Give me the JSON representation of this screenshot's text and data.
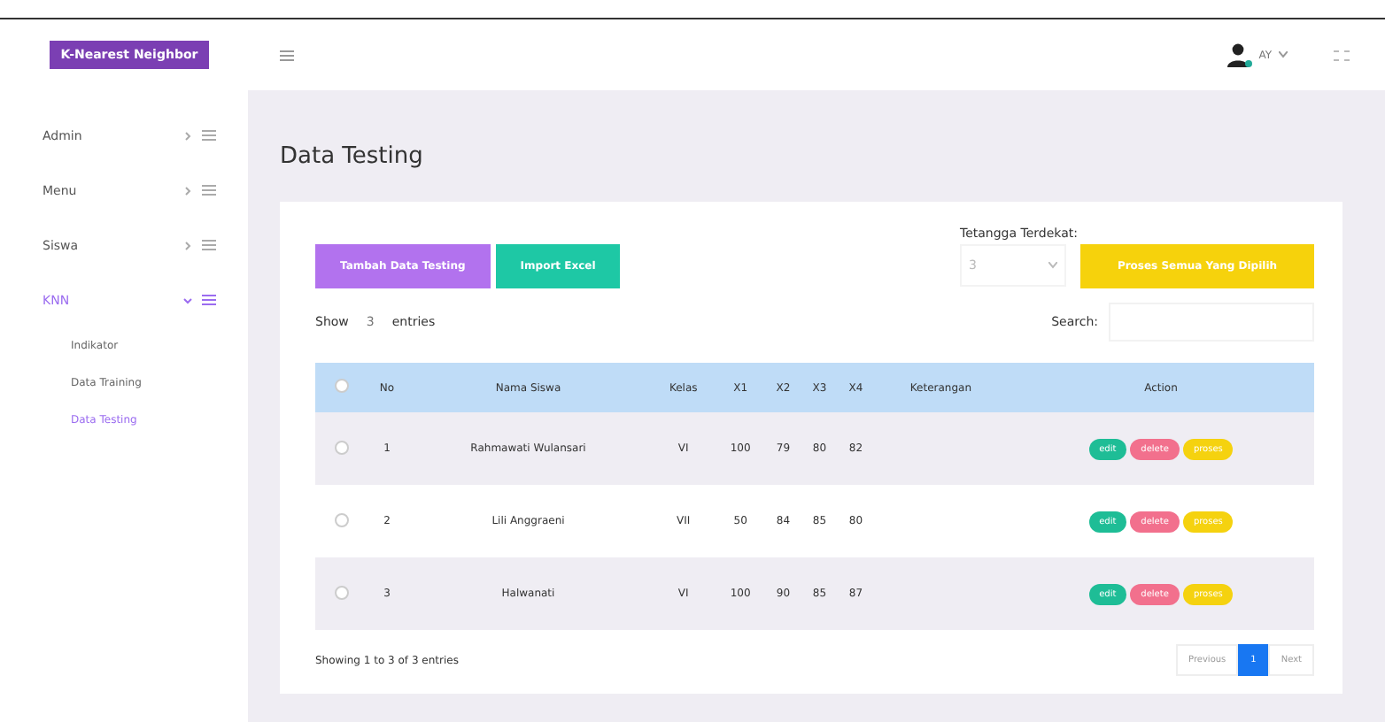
{
  "brand": "K-Nearest Neighbor",
  "sidebar": {
    "items": [
      {
        "label": "Admin",
        "selected": false
      },
      {
        "label": "Menu",
        "selected": false
      },
      {
        "label": "Siswa",
        "selected": false
      },
      {
        "label": "KNN",
        "selected": true,
        "expanded": true,
        "children": [
          {
            "label": "Indikator",
            "selected": false
          },
          {
            "label": "Data Training",
            "selected": false
          },
          {
            "label": "Data Testing",
            "selected": true
          }
        ]
      }
    ]
  },
  "header": {
    "user": "AY"
  },
  "page_title": "Data Testing",
  "buttons": {
    "add": "Tambah Data Testing",
    "import": "Import Excel",
    "process": "Proses Semua Yang Dipilih"
  },
  "neighbors": {
    "label": "Tetangga Terdekat:",
    "value": "3"
  },
  "show": {
    "before": "Show",
    "value": "3",
    "after": "entries"
  },
  "search": {
    "label": "Search:"
  },
  "table": {
    "columns": [
      "No",
      "Nama Siswa",
      "Kelas",
      "X1",
      "X2",
      "X3",
      "X4",
      "Keterangan",
      "Action"
    ],
    "select_all": {
      "checked": false
    },
    "rows": [
      {
        "checked": false,
        "cells": [
          "1",
          "Rahmawati Wulansari",
          "VI",
          "100",
          "79",
          "80",
          "82",
          ""
        ],
        "actions": [
          "edit",
          "delete",
          "proses"
        ]
      },
      {
        "checked": false,
        "cells": [
          "2",
          "Lili Anggraeni",
          "VII",
          "50",
          "84",
          "85",
          "80",
          ""
        ],
        "actions": [
          "edit",
          "delete",
          "proses"
        ]
      },
      {
        "checked": false,
        "cells": [
          "3",
          "Halwanati",
          "VI",
          "100",
          "90",
          "85",
          "87",
          ""
        ],
        "actions": [
          "edit",
          "delete",
          "proses"
        ]
      }
    ]
  },
  "footer": {
    "info": "Showing 1 to 3 of 3 entries",
    "pages": [
      {
        "label": "Previous",
        "selected": false
      },
      {
        "label": "1",
        "selected": true
      },
      {
        "label": "Next",
        "selected": false
      }
    ]
  }
}
